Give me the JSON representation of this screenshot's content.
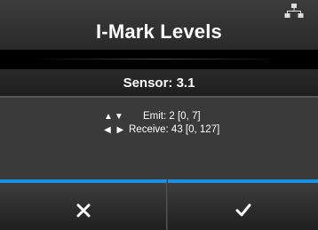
{
  "header": {
    "title": "I-Mark Levels",
    "network_icon": "network-icon"
  },
  "sensor": {
    "label": "Sensor: 3.1"
  },
  "settings": [
    {
      "arrows": "▲▼",
      "text": "Emit:  2  [0, 7]"
    },
    {
      "arrows": "◀ ▶",
      "text": "Receive: 43 [0, 127]"
    }
  ],
  "buttons": {
    "cancel_icon": "close-icon",
    "ok_icon": "check-icon"
  },
  "colors": {
    "accent": "#1d8fe0",
    "background": "#3a3a3a"
  }
}
